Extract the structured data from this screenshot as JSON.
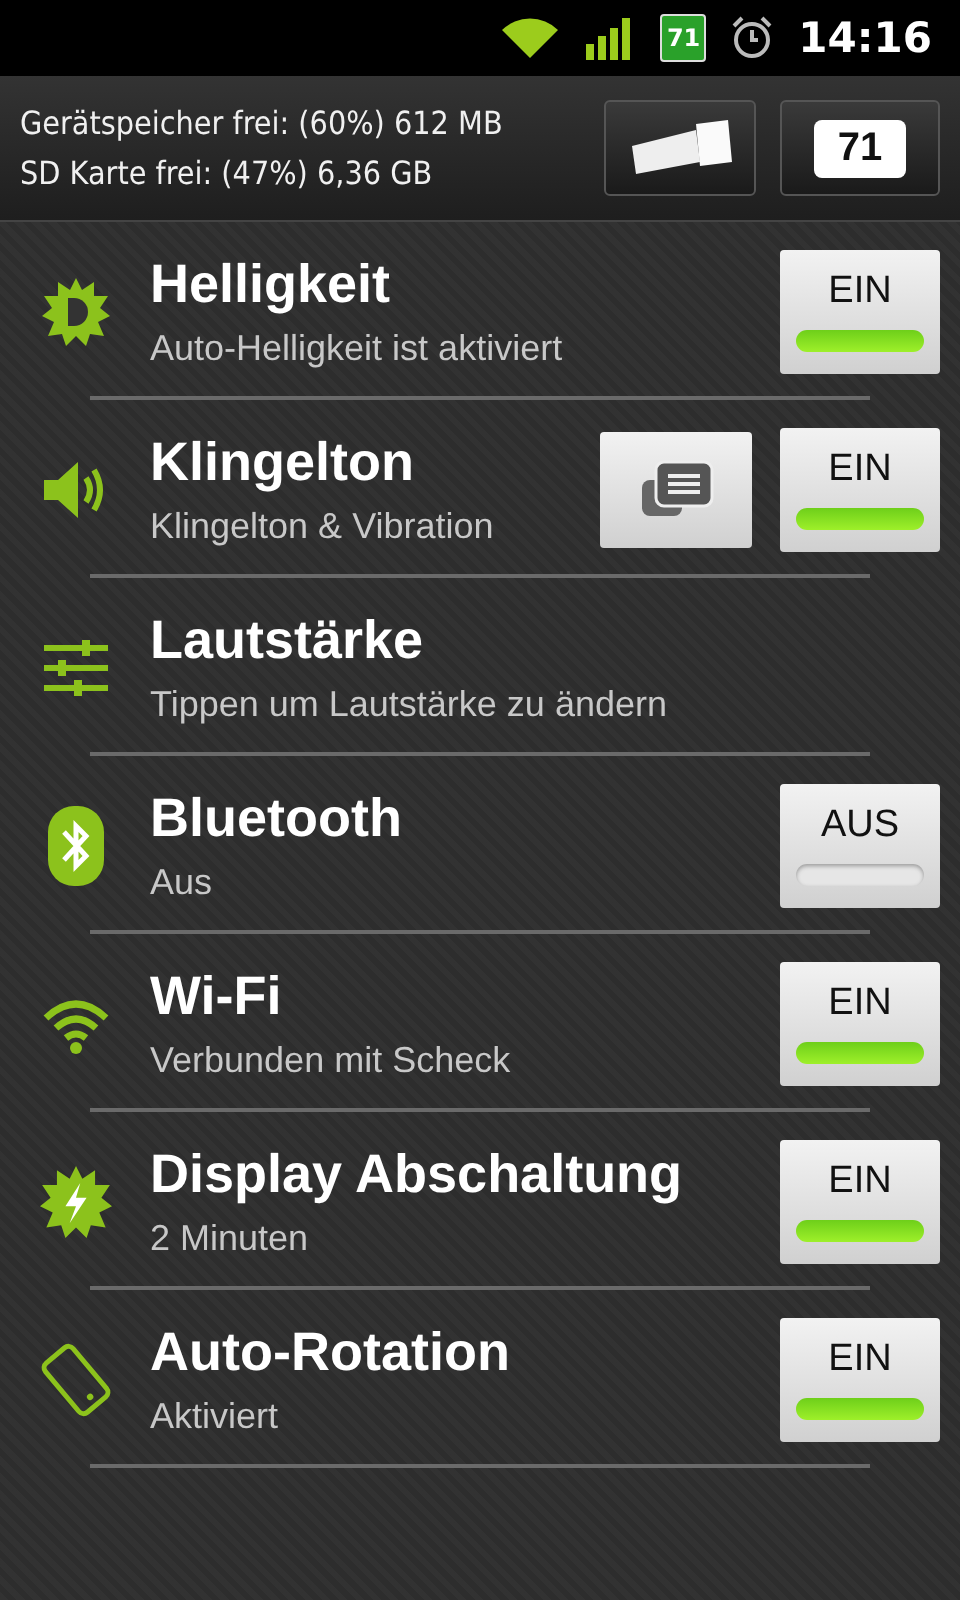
{
  "status_bar": {
    "battery": "71",
    "time": "14:16"
  },
  "header": {
    "lines": [
      "Gerätspeicher frei: (60%) 612 MB",
      "SD Karte frei: (47%) 6,36 GB"
    ],
    "battery_level": "71"
  },
  "rows": [
    {
      "kind": "toggle",
      "title": "Helligkeit",
      "subtitle": "Auto-Helligkeit ist aktiviert",
      "label": "EIN",
      "on": true
    },
    {
      "kind": "toggle_menu",
      "title": "Klingelton",
      "subtitle": "Klingelton & Vibration",
      "label": "EIN",
      "on": true
    },
    {
      "kind": "plain",
      "title": "Lautstärke",
      "subtitle": "Tippen um Lautstärke zu ändern"
    },
    {
      "kind": "toggle",
      "title": "Bluetooth",
      "subtitle": "Aus",
      "label": "AUS",
      "on": false
    },
    {
      "kind": "toggle",
      "title": "Wi-Fi",
      "subtitle": "Verbunden mit Scheck",
      "label": "EIN",
      "on": true
    },
    {
      "kind": "toggle",
      "title": "Display Abschaltung",
      "subtitle": "2 Minuten",
      "label": "EIN",
      "on": true
    },
    {
      "kind": "toggle",
      "title": "Auto-Rotation",
      "subtitle": "Aktiviert",
      "label": "EIN",
      "on": true
    }
  ]
}
